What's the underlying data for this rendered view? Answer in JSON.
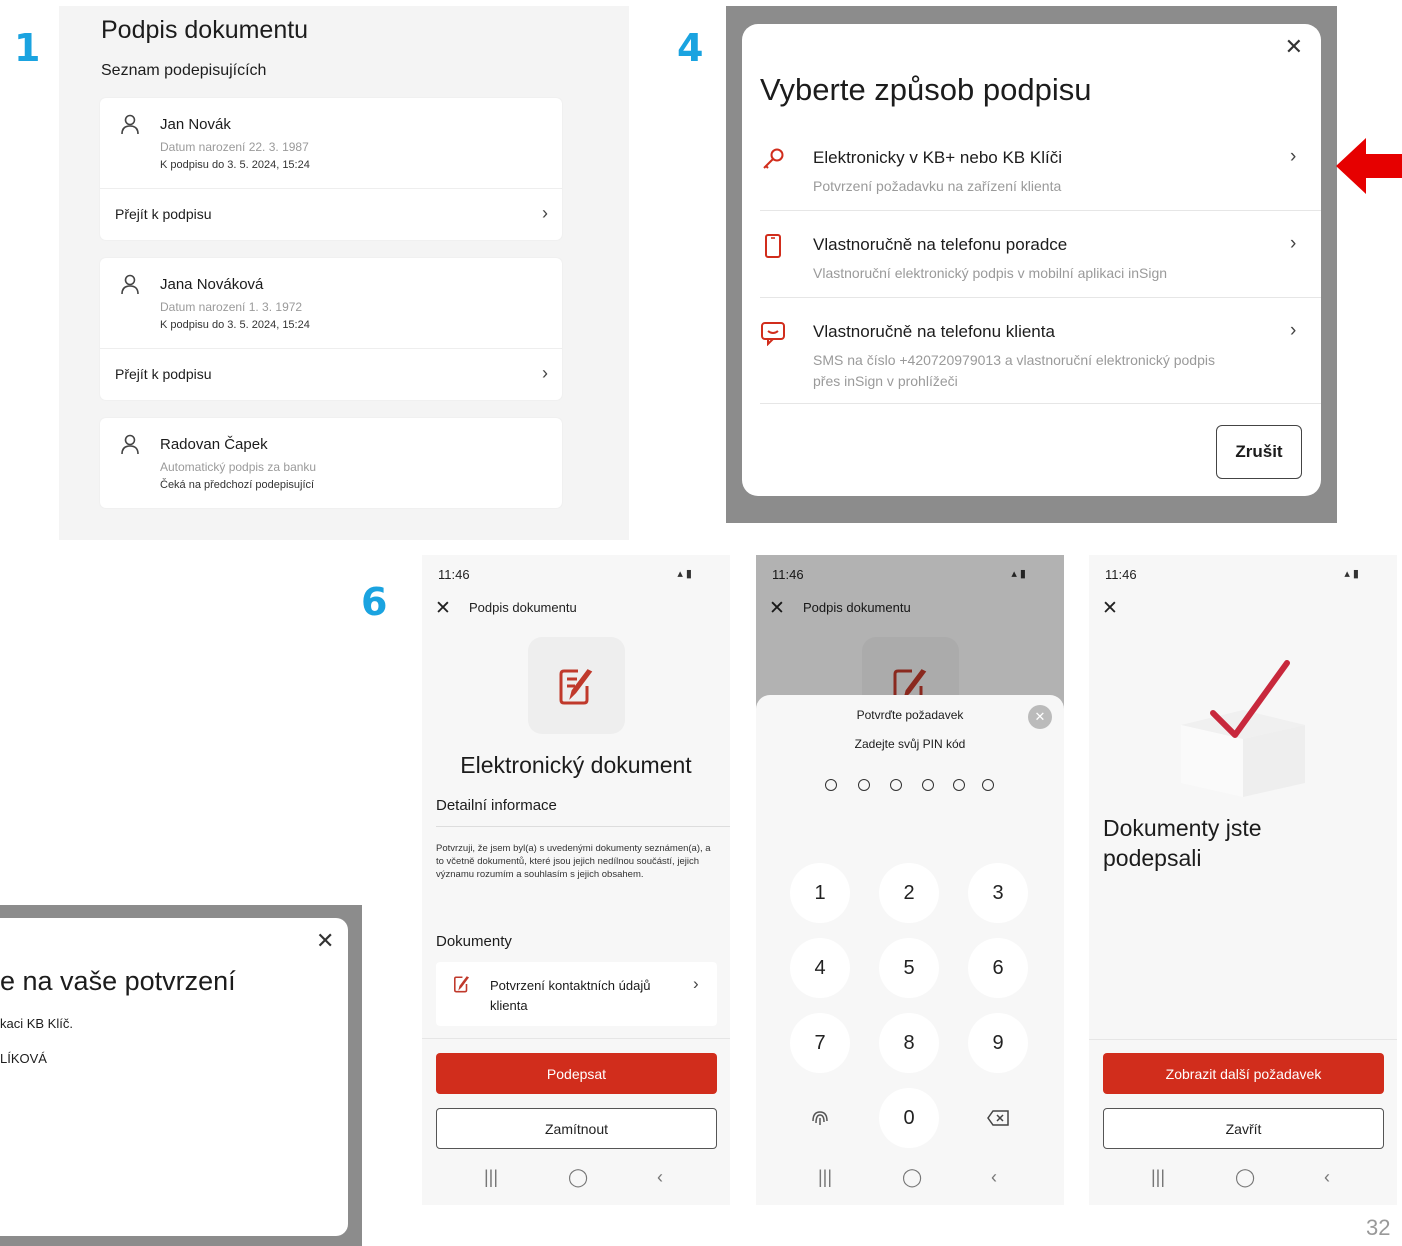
{
  "steps": {
    "one": "1",
    "four": "4",
    "six": "6"
  },
  "panel1": {
    "title": "Podpis dokumentu",
    "subtitle": "Seznam podepisujících",
    "signers": [
      {
        "name": "Jan Novák",
        "line2": "Datum narození 22. 3. 1987",
        "line3": "K podpisu do 3. 5. 2024, 15:24",
        "action": "Přejít k podpisu"
      },
      {
        "name": "Jana Nováková",
        "line2": "Datum narození 1. 3. 1972",
        "line3": "K podpisu do 3. 5. 2024, 15:24",
        "action": "Přejít k podpisu"
      },
      {
        "name": "Radovan Čapek",
        "line2": "Automatický podpis za banku",
        "line3": "Čeká na předchozí podepisující"
      }
    ]
  },
  "panel4": {
    "title": "Vyberte způsob podpisu",
    "options": [
      {
        "title": "Elektronicky v KB+ nebo KB Klíči",
        "desc": "Potvrzení požadavku na zařízení klienta",
        "icon": "key-icon"
      },
      {
        "title": "Vlastnoručně na telefonu poradce",
        "desc": "Vlastnoruční elektronický podpis v mobilní aplikaci inSign",
        "icon": "phone-icon"
      },
      {
        "title": "Vlastnoručně na telefonu klienta",
        "desc": "SMS na číslo +420720979013 a vlastnoruční elektronický podpis přes inSign v prohlížeči",
        "icon": "message-icon"
      }
    ],
    "cancel": "Zrušit"
  },
  "panel5": {
    "title": "e na vaše potvrzení",
    "line1": "kaci KB Klíč.",
    "line2": "LÍKOVÁ"
  },
  "phone1": {
    "time": "11:46",
    "header": "Podpis dokumentu",
    "doc_title": "Elektronický dokument",
    "detail_heading": "Detailní informace",
    "detail_text": "Potvrzuji, že jsem byl(a) s uvedenými dokumenty seznámen(a), a to včetně dokumentů, které jsou jejich nedílnou součástí, jejich významu rozumím a souhlasím s jejich obsahem.",
    "docs_heading": "Dokumenty",
    "doc_item": "Potvrzení kontaktních údajů klienta",
    "sign": "Podepsat",
    "reject": "Zamítnout"
  },
  "phone2": {
    "time": "11:46",
    "header": "Podpis dokumentu",
    "sheet_title": "Potvrďte požadavek",
    "pin_prompt": "Zadejte svůj PIN kód",
    "keys": [
      "1",
      "2",
      "3",
      "4",
      "5",
      "6",
      "7",
      "8",
      "9",
      "0"
    ]
  },
  "phone3": {
    "time": "11:46",
    "done_title": "Dokumenty jste podepsali",
    "next": "Zobrazit další požadavek",
    "close": "Zavřít"
  },
  "page_number": "32",
  "colors": {
    "accent": "#d12d1c",
    "step_blue": "#1aa3e0",
    "arrow_red": "#e60000"
  }
}
